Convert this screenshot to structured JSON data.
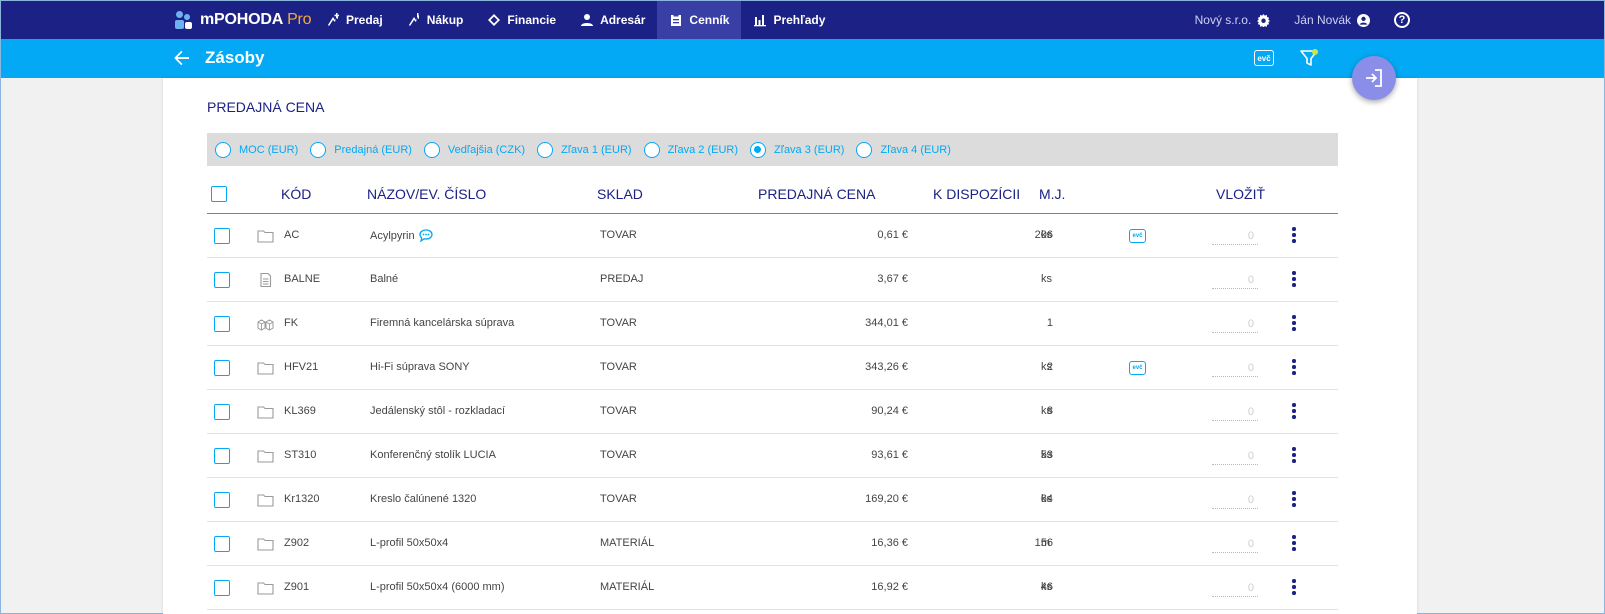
{
  "app": {
    "name": "mPOHODA",
    "edition": "Pro"
  },
  "nav": [
    {
      "label": "Predaj",
      "icon": "sales-icon",
      "active": false
    },
    {
      "label": "Nákup",
      "icon": "purchase-icon",
      "active": false
    },
    {
      "label": "Financie",
      "icon": "finance-icon",
      "active": false
    },
    {
      "label": "Adresár",
      "icon": "person-icon",
      "active": false
    },
    {
      "label": "Cenník",
      "icon": "pricelist-icon",
      "active": true
    },
    {
      "label": "Prehľady",
      "icon": "bar-chart-icon",
      "active": false
    }
  ],
  "header": {
    "company": "Nový s.r.o.",
    "user": "Ján Novák",
    "help": "?"
  },
  "page": {
    "title": "Zásoby",
    "evc_label": "evč"
  },
  "section": {
    "title": "PREDAJNÁ CENA"
  },
  "price_types": [
    {
      "label": "MOC (EUR)",
      "checked": false
    },
    {
      "label": "Predajná (EUR)",
      "checked": false
    },
    {
      "label": "Vedľajšia (CZK)",
      "checked": false
    },
    {
      "label": "Zľava 1 (EUR)",
      "checked": false
    },
    {
      "label": "Zľava 2 (EUR)",
      "checked": false
    },
    {
      "label": "Zľava 3 (EUR)",
      "checked": true
    },
    {
      "label": "Zľava 4 (EUR)",
      "checked": false
    }
  ],
  "table": {
    "headers": {
      "code": "KÓD",
      "name": "NÁZOV/EV. ČÍSLO",
      "store": "SKLAD",
      "price": "PREDAJNÁ CENA",
      "available": "K DISPOZÍCII",
      "unit": "M.J.",
      "insert": "VLOŽIŤ"
    },
    "rows": [
      {
        "type": "folder",
        "code": "AC",
        "name": "Acylpyrin",
        "note": true,
        "store": "TOVAR",
        "price": "0,61 €",
        "available": "206",
        "unit": "ks",
        "evc": true,
        "insert": "0"
      },
      {
        "type": "service",
        "code": "BALNE",
        "name": "Balné",
        "note": false,
        "store": "PREDAJ",
        "price": "3,67 €",
        "available": "",
        "unit": "ks",
        "evc": false,
        "insert": "0"
      },
      {
        "type": "set",
        "code": "FK",
        "name": "Firemná kancelárska súprava",
        "note": false,
        "store": "TOVAR",
        "price": "344,01 €",
        "available": "1",
        "unit": "",
        "evc": false,
        "insert": "0"
      },
      {
        "type": "folder",
        "code": "HFV21",
        "name": "Hi-Fi súprava SONY",
        "note": false,
        "store": "TOVAR",
        "price": "343,26 €",
        "available": "2",
        "unit": "ks",
        "evc": true,
        "insert": "0"
      },
      {
        "type": "folder",
        "code": "KL369",
        "name": "Jedálenský stôl - rozkladací",
        "note": false,
        "store": "TOVAR",
        "price": "90,24 €",
        "available": "8",
        "unit": "ks",
        "evc": false,
        "insert": "0"
      },
      {
        "type": "folder",
        "code": "ST310",
        "name": "Konferenčný stolík LUCIA",
        "note": false,
        "store": "TOVAR",
        "price": "93,61 €",
        "available": "53",
        "unit": "ks",
        "evc": false,
        "insert": "0"
      },
      {
        "type": "folder",
        "code": "Kr1320",
        "name": "Kreslo čalúnené 1320",
        "note": false,
        "store": "TOVAR",
        "price": "169,20 €",
        "available": "64",
        "unit": "ks",
        "evc": false,
        "insert": "0"
      },
      {
        "type": "folder",
        "code": "Z902",
        "name": "L-profil 50x50x4",
        "note": false,
        "store": "MATERIÁL",
        "price": "16,36 €",
        "available": "156",
        "unit": "m",
        "evc": false,
        "insert": "0"
      },
      {
        "type": "folder",
        "code": "Z901",
        "name": "L-profil 50x50x4 (6000 mm)",
        "note": false,
        "store": "MATERIÁL",
        "price": "16,92 €",
        "available": "46",
        "unit": "ks",
        "evc": false,
        "insert": "0"
      }
    ]
  }
}
